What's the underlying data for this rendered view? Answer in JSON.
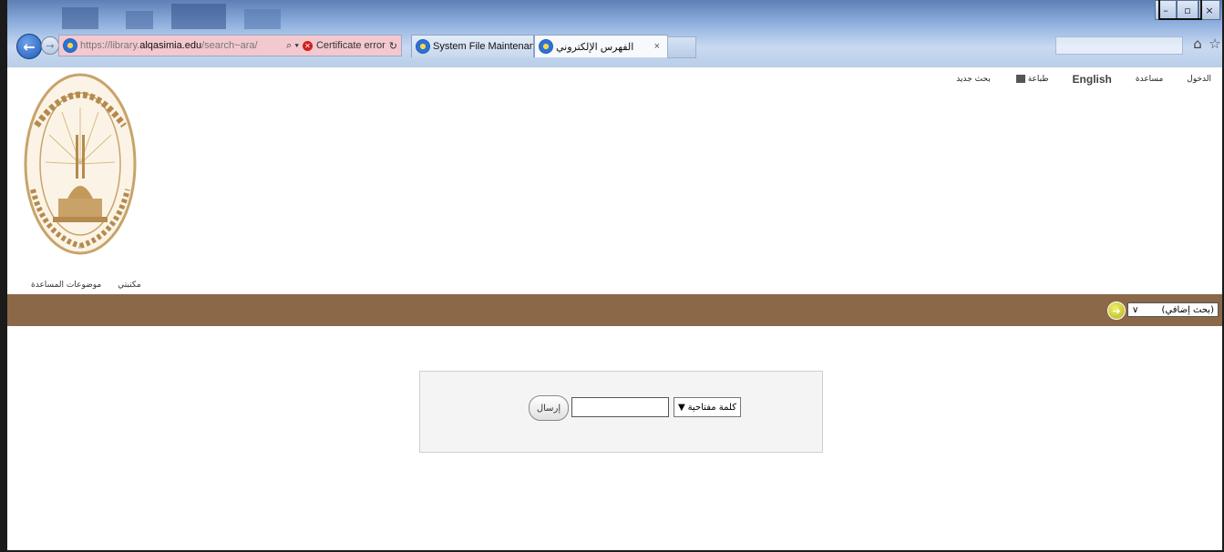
{
  "browser": {
    "address": {
      "url_prefix": "https://library.",
      "url_host": "alqasimia.edu",
      "url_path": "/search~ara/",
      "search_glyph": "⌕ ▾",
      "cert_error": "Certificate error",
      "refresh_glyph": "↻"
    },
    "tabs": [
      {
        "label": "System File Maintenance - Ho..."
      },
      {
        "label": "الفهرس الإلكتروني",
        "close": "×"
      }
    ],
    "controls": {
      "minimize": "–",
      "maximize": "▫",
      "close": "×"
    },
    "nav": {
      "back": "←",
      "forward": "→"
    },
    "toolbar": {
      "home": "⌂",
      "favorites": "☆"
    }
  },
  "header": {
    "links": {
      "login": "الدخول",
      "help": "مساعدة",
      "english": "English",
      "print": "طباعة",
      "new_search": "بحث جديد"
    },
    "sublinks": {
      "my_library": "مكتبتي",
      "help_topics": "موضوعات المساعدة"
    }
  },
  "logo": {
    "arc_text": "الجامعة القاسمية",
    "bottom_text": "AL QASIMIA UNIVERSITY",
    "year_left": "2014",
    "year_right": "1435"
  },
  "searchbar": {
    "advanced_label": "(بحث إضافي)",
    "go_glyph": "➔"
  },
  "search": {
    "field_type": "كلمة مفتاحية",
    "query": "",
    "submit_label": "إرسال"
  },
  "colors": {
    "brown_bar": "#8b6848",
    "address_error_bg": "#f3c8cf",
    "logo_gold": "#c8a36a"
  }
}
